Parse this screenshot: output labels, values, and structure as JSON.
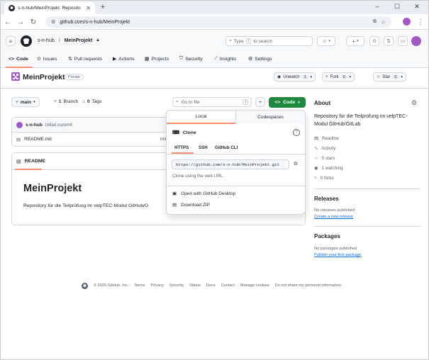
{
  "browser": {
    "tab_title": "s-n-hub/MeinProjekt: Reposito",
    "url": "github.com/s-n-hub/MeinProjekt"
  },
  "github": {
    "owner": "s-n-hub",
    "repo": "MeinProjekt",
    "search_placeholder": "Type",
    "search_suffix": "to search",
    "search_key": "/",
    "tabs": [
      "Code",
      "Issues",
      "Pull requests",
      "Actions",
      "Projects",
      "Security",
      "Insights",
      "Settings"
    ]
  },
  "repo": {
    "title": "MeinProjekt",
    "visibility": "Private",
    "unwatch_label": "Unwatch",
    "unwatch_count": "1",
    "fork_label": "Fork",
    "fork_count": "0",
    "star_label": "Star",
    "star_count": "0"
  },
  "files": {
    "branch": "main",
    "branch_count": "1",
    "branch_label": "Branch",
    "tag_count": "0",
    "tag_label": "Tags",
    "goto_placeholder": "Go to file",
    "goto_key": "t",
    "code_button": "Code",
    "commit_author": "s-n-hub",
    "commit_message": "Initial commit",
    "file_name": "README.md",
    "file_commit": "Initial commit"
  },
  "readme": {
    "tab": "README",
    "heading": "MeinProjekt",
    "text": "Repository für die Teilprüfung im velpTEC-Modul GitHub/G"
  },
  "clone": {
    "tab_local": "Local",
    "tab_codespaces": "Codespaces",
    "title": "Clone",
    "proto_https": "HTTPS",
    "proto_ssh": "SSH",
    "proto_cli": "GitHub CLI",
    "clone_url": "https://github.com/s-n-hub/MeinProjekt.git",
    "hint": "Clone using the web URL.",
    "open_desktop": "Open with GitHub Desktop",
    "download_zip": "Download ZIP"
  },
  "sidebar": {
    "about_title": "About",
    "description": "Repository für die Teilprüfung im velpTEC-Modul GitHub/GitLab",
    "items": [
      "Readme",
      "Activity",
      "0 stars",
      "1 watching",
      "0 forks"
    ],
    "releases_title": "Releases",
    "releases_none": "No releases published",
    "releases_link": "Create a new release",
    "packages_title": "Packages",
    "packages_none": "No packages published",
    "packages_link": "Publish your first package"
  },
  "footer": {
    "copyright": "© 2025 GitHub, Inc.",
    "links": [
      "Terms",
      "Privacy",
      "Security",
      "Status",
      "Docs",
      "Contact",
      "Manage cookies",
      "Do not share my personal information"
    ]
  },
  "colors": {
    "accent_green": "#1f883d",
    "link_blue": "#0969da",
    "tab_underline": "#fd8c73",
    "repo_avatar": "#a259c6"
  }
}
